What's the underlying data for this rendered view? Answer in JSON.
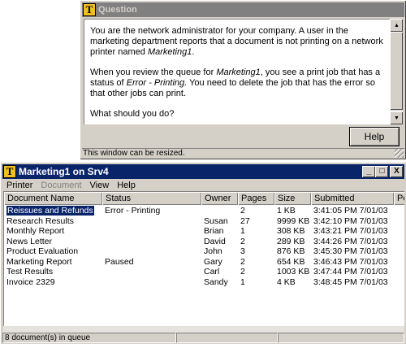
{
  "question_window": {
    "title": "Question",
    "icon_letter": "T",
    "paragraphs": [
      [
        "You are the network administrator for your company. A user in the marketing department reports that a document is not printing on a network printer named ",
        "Marketing1",
        "."
      ],
      [
        "When you review the queue for ",
        "Marketing1",
        ", you see a print job that has a status of ",
        "Error - Printing.",
        " You need to delete the job that has the error so that other jobs can print."
      ],
      [
        "What should you do?"
      ]
    ],
    "help_label": "Help",
    "status": "This window can be resized."
  },
  "queue_window": {
    "title": "Marketing1 on Srv4",
    "icon_letter": "T",
    "controls": {
      "minimize": "_",
      "maximize": "□",
      "close": "X"
    },
    "menu": [
      {
        "label": "Printer",
        "enabled": true
      },
      {
        "label": "Document",
        "enabled": false
      },
      {
        "label": "View",
        "enabled": true
      },
      {
        "label": "Help",
        "enabled": true
      }
    ],
    "columns": [
      "Document Name",
      "Status",
      "Owner",
      "Pages",
      "Size",
      "Submitted",
      "Po"
    ],
    "rows": [
      [
        "Reissues and Refunds",
        "Error - Printing",
        "",
        "2",
        "1 KB",
        "3:41:05 PM 7/01/03",
        ""
      ],
      [
        "Research Results",
        "",
        "Susan",
        "27",
        "9999 KB",
        "3:42:10 PM 7/01/03",
        ""
      ],
      [
        "Monthly Report",
        "",
        "Brian",
        "1",
        "308 KB",
        "3:43:21 PM 7/01/03",
        ""
      ],
      [
        "News Letter",
        "",
        "David",
        "2",
        "289 KB",
        "3:44:26 PM 7/01/03",
        ""
      ],
      [
        "Product Evaluation",
        "",
        "John",
        "3",
        "876 KB",
        "3:45:30 PM 7/01/03",
        ""
      ],
      [
        "Marketing Report",
        "Paused",
        "Gary",
        "2",
        "654 KB",
        "3:46:43 PM 7/01/03",
        ""
      ],
      [
        "Test Results",
        "",
        "Carl",
        "2",
        "1003 KB",
        "3:47:44 PM 7/01/03",
        ""
      ],
      [
        "Invoice 2329",
        "",
        "Sandy",
        "1",
        "4 KB",
        "3:48:45 PM 7/01/03",
        ""
      ]
    ],
    "selected_row": 0,
    "status": "8 document(s) in queue"
  },
  "colors": {
    "active_title": "#0a246a",
    "inactive_title": "#808080",
    "face": "#d4d0c8"
  }
}
